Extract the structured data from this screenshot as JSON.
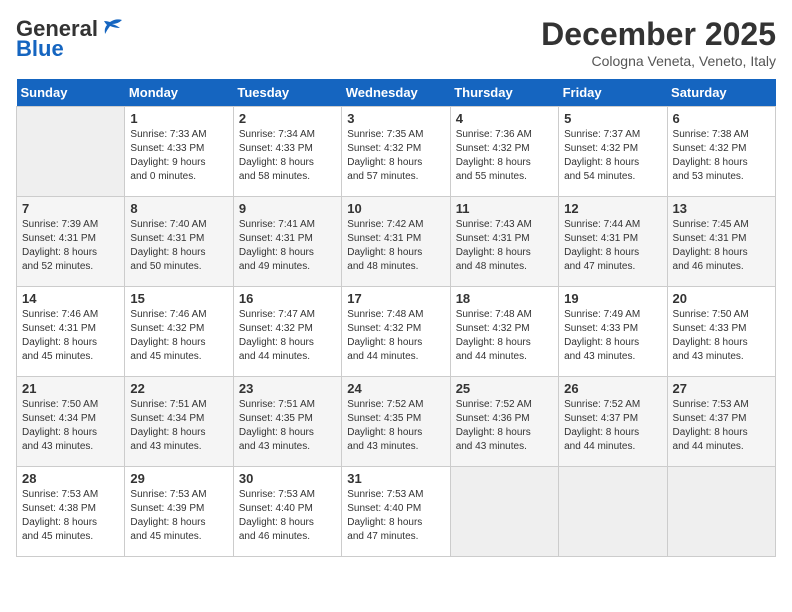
{
  "header": {
    "logo_general": "General",
    "logo_blue": "Blue",
    "month_title": "December 2025",
    "subtitle": "Cologna Veneta, Veneto, Italy"
  },
  "days_of_week": [
    "Sunday",
    "Monday",
    "Tuesday",
    "Wednesday",
    "Thursday",
    "Friday",
    "Saturday"
  ],
  "weeks": [
    [
      {
        "day": "",
        "empty": true
      },
      {
        "day": "1",
        "sunrise": "7:33 AM",
        "sunset": "4:33 PM",
        "daylight": "9 hours and 0 minutes."
      },
      {
        "day": "2",
        "sunrise": "7:34 AM",
        "sunset": "4:33 PM",
        "daylight": "8 hours and 58 minutes."
      },
      {
        "day": "3",
        "sunrise": "7:35 AM",
        "sunset": "4:32 PM",
        "daylight": "8 hours and 57 minutes."
      },
      {
        "day": "4",
        "sunrise": "7:36 AM",
        "sunset": "4:32 PM",
        "daylight": "8 hours and 55 minutes."
      },
      {
        "day": "5",
        "sunrise": "7:37 AM",
        "sunset": "4:32 PM",
        "daylight": "8 hours and 54 minutes."
      },
      {
        "day": "6",
        "sunrise": "7:38 AM",
        "sunset": "4:32 PM",
        "daylight": "8 hours and 53 minutes."
      }
    ],
    [
      {
        "day": "7",
        "sunrise": "7:39 AM",
        "sunset": "4:31 PM",
        "daylight": "8 hours and 52 minutes."
      },
      {
        "day": "8",
        "sunrise": "7:40 AM",
        "sunset": "4:31 PM",
        "daylight": "8 hours and 50 minutes."
      },
      {
        "day": "9",
        "sunrise": "7:41 AM",
        "sunset": "4:31 PM",
        "daylight": "8 hours and 49 minutes."
      },
      {
        "day": "10",
        "sunrise": "7:42 AM",
        "sunset": "4:31 PM",
        "daylight": "8 hours and 48 minutes."
      },
      {
        "day": "11",
        "sunrise": "7:43 AM",
        "sunset": "4:31 PM",
        "daylight": "8 hours and 48 minutes."
      },
      {
        "day": "12",
        "sunrise": "7:44 AM",
        "sunset": "4:31 PM",
        "daylight": "8 hours and 47 minutes."
      },
      {
        "day": "13",
        "sunrise": "7:45 AM",
        "sunset": "4:31 PM",
        "daylight": "8 hours and 46 minutes."
      }
    ],
    [
      {
        "day": "14",
        "sunrise": "7:46 AM",
        "sunset": "4:31 PM",
        "daylight": "8 hours and 45 minutes."
      },
      {
        "day": "15",
        "sunrise": "7:46 AM",
        "sunset": "4:32 PM",
        "daylight": "8 hours and 45 minutes."
      },
      {
        "day": "16",
        "sunrise": "7:47 AM",
        "sunset": "4:32 PM",
        "daylight": "8 hours and 44 minutes."
      },
      {
        "day": "17",
        "sunrise": "7:48 AM",
        "sunset": "4:32 PM",
        "daylight": "8 hours and 44 minutes."
      },
      {
        "day": "18",
        "sunrise": "7:48 AM",
        "sunset": "4:32 PM",
        "daylight": "8 hours and 44 minutes."
      },
      {
        "day": "19",
        "sunrise": "7:49 AM",
        "sunset": "4:33 PM",
        "daylight": "8 hours and 43 minutes."
      },
      {
        "day": "20",
        "sunrise": "7:50 AM",
        "sunset": "4:33 PM",
        "daylight": "8 hours and 43 minutes."
      }
    ],
    [
      {
        "day": "21",
        "sunrise": "7:50 AM",
        "sunset": "4:34 PM",
        "daylight": "8 hours and 43 minutes."
      },
      {
        "day": "22",
        "sunrise": "7:51 AM",
        "sunset": "4:34 PM",
        "daylight": "8 hours and 43 minutes."
      },
      {
        "day": "23",
        "sunrise": "7:51 AM",
        "sunset": "4:35 PM",
        "daylight": "8 hours and 43 minutes."
      },
      {
        "day": "24",
        "sunrise": "7:52 AM",
        "sunset": "4:35 PM",
        "daylight": "8 hours and 43 minutes."
      },
      {
        "day": "25",
        "sunrise": "7:52 AM",
        "sunset": "4:36 PM",
        "daylight": "8 hours and 43 minutes."
      },
      {
        "day": "26",
        "sunrise": "7:52 AM",
        "sunset": "4:37 PM",
        "daylight": "8 hours and 44 minutes."
      },
      {
        "day": "27",
        "sunrise": "7:53 AM",
        "sunset": "4:37 PM",
        "daylight": "8 hours and 44 minutes."
      }
    ],
    [
      {
        "day": "28",
        "sunrise": "7:53 AM",
        "sunset": "4:38 PM",
        "daylight": "8 hours and 45 minutes."
      },
      {
        "day": "29",
        "sunrise": "7:53 AM",
        "sunset": "4:39 PM",
        "daylight": "8 hours and 45 minutes."
      },
      {
        "day": "30",
        "sunrise": "7:53 AM",
        "sunset": "4:40 PM",
        "daylight": "8 hours and 46 minutes."
      },
      {
        "day": "31",
        "sunrise": "7:53 AM",
        "sunset": "4:40 PM",
        "daylight": "8 hours and 47 minutes."
      },
      {
        "day": "",
        "empty": true
      },
      {
        "day": "",
        "empty": true
      },
      {
        "day": "",
        "empty": true
      }
    ]
  ],
  "labels": {
    "sunrise": "Sunrise:",
    "sunset": "Sunset:",
    "daylight": "Daylight:"
  }
}
